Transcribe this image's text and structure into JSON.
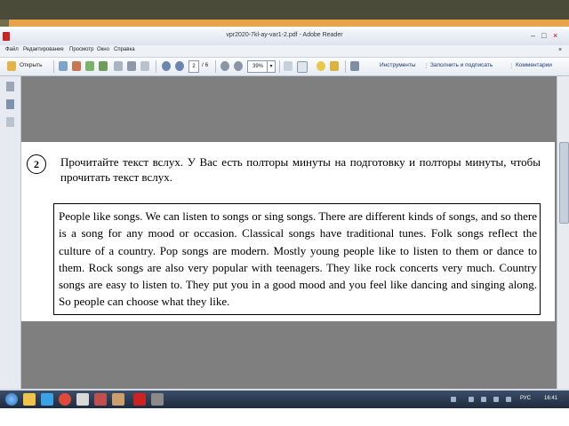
{
  "window": {
    "title": "vpr2020-7kl-ay-var1-2.pdf - Adobe Reader",
    "controls": [
      "–",
      "□",
      "×"
    ]
  },
  "menu": [
    "Файл",
    "Редактирование",
    "Просмотр",
    "Окно",
    "Справка"
  ],
  "toolbar": {
    "open_label": "Открыть",
    "page_current": "2",
    "page_total": "/ 6",
    "zoom": "39%",
    "tools_label": "Инструменты",
    "fill_sign_label": "Заполнить и подписать",
    "comments_label": "Комментарии"
  },
  "document": {
    "task_number": "2",
    "instruction": "Прочитайте текст вслух. У Вас есть полторы минуты на подготовку и полторы минуты, чтобы прочитать текст вслух.",
    "text": "People like songs. We can listen to songs or sing songs. There are different kinds of songs, and so there is a song for any mood or occasion. Classical songs have traditional tunes. Folk songs reflect the culture of a country. Pop songs are modern. Mostly young people like to listen to them or dance to them. Rock songs are also very popular with teenagers. They like rock concerts very much. Country songs are easy to listen to. They put you in a good mood and you feel like dancing and singing along. So people can choose what they like."
  },
  "taskbar": {
    "language": "РУС",
    "time": "16:41"
  },
  "colors": {
    "deco_dark": "#4b4b3a",
    "deco_orange": "#e8a24a",
    "doc_background": "#7f7f7f",
    "taskbar": "#2a3a52"
  }
}
